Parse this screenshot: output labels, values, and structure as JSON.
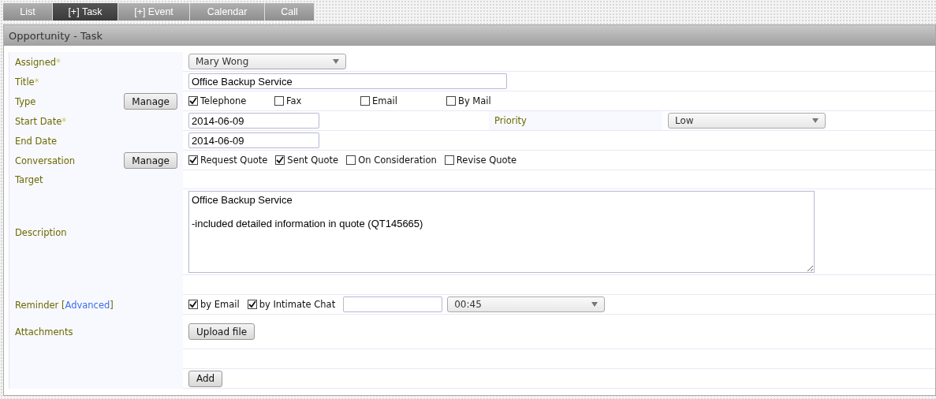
{
  "tabs": [
    {
      "label": "List",
      "selected": false
    },
    {
      "label": "[+] Task",
      "selected": true
    },
    {
      "label": "[+] Event",
      "selected": false
    },
    {
      "label": "Calendar",
      "selected": false
    },
    {
      "label": "Call",
      "selected": false
    }
  ],
  "panel_title": "Opportunity - Task",
  "rows": [
    {
      "kind": "select",
      "label": "Assigned",
      "mark": "*",
      "value": "Mary Wong"
    },
    {
      "kind": "text",
      "label": "Title",
      "mark": "*",
      "value": "Office Backup Service"
    },
    {
      "kind": "checks-grid",
      "label": "Type",
      "button": "Manage",
      "options": [
        {
          "label": "Telephone",
          "checked": true
        },
        {
          "label": "Fax",
          "checked": false
        },
        {
          "label": "Email",
          "checked": false
        },
        {
          "label": "By Mail",
          "checked": false
        }
      ]
    },
    {
      "kind": "date-priority",
      "label": "Start Date",
      "mark": "*",
      "value": "2014-06-09",
      "side_label": "Priority",
      "side_value": "Low"
    },
    {
      "kind": "date",
      "label": "End Date",
      "value": "2014-06-09"
    },
    {
      "kind": "checks",
      "label": "Conversation",
      "button": "Manage",
      "options": [
        {
          "label": "Request Quote",
          "checked": true
        },
        {
          "label": "Sent Quote",
          "checked": true
        },
        {
          "label": "On Consideration",
          "checked": false
        },
        {
          "label": "Revise Quote",
          "checked": false
        }
      ]
    },
    {
      "kind": "empty",
      "label": "Target"
    },
    {
      "kind": "textarea",
      "label": "Description",
      "value": "Office Backup Service\n\n-included detailed information in quote (QT145665)"
    },
    {
      "kind": "spacer"
    },
    {
      "kind": "reminder",
      "label": "Reminder [",
      "link": "Advanced",
      "label_end": "]",
      "options": [
        {
          "label": "by Email",
          "checked": true
        },
        {
          "label": "by Intimate Chat",
          "checked": true
        }
      ],
      "time": "00:45"
    },
    {
      "kind": "upload",
      "label": "Attachments",
      "button": "Upload file"
    },
    {
      "kind": "spacer"
    },
    {
      "kind": "submit",
      "button": "Add"
    }
  ]
}
